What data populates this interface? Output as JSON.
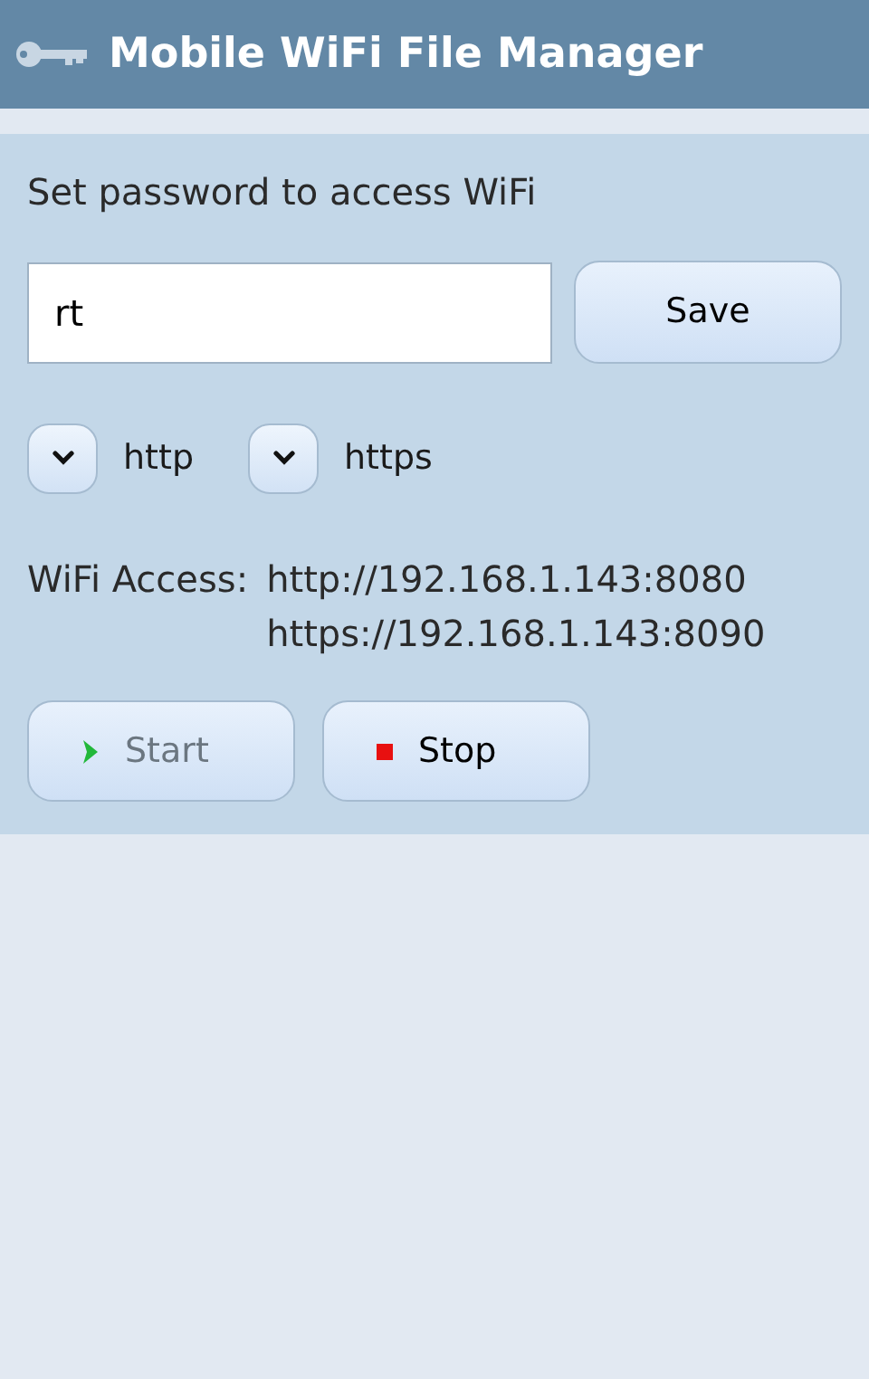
{
  "header": {
    "title": "Mobile WiFi File Manager"
  },
  "password": {
    "label": "Set password to access WiFi",
    "value": "rt",
    "save_button": "Save"
  },
  "protocols": [
    {
      "label": "http"
    },
    {
      "label": "https"
    }
  ],
  "access": {
    "label": "WiFi Access:",
    "urls": [
      "http://192.168.1.143:8080",
      "https://192.168.1.143:8090"
    ]
  },
  "buttons": [
    {
      "kind": "start",
      "label": "Start",
      "disabled": true
    },
    {
      "kind": "stop",
      "label": "Stop",
      "disabled": false
    }
  ]
}
